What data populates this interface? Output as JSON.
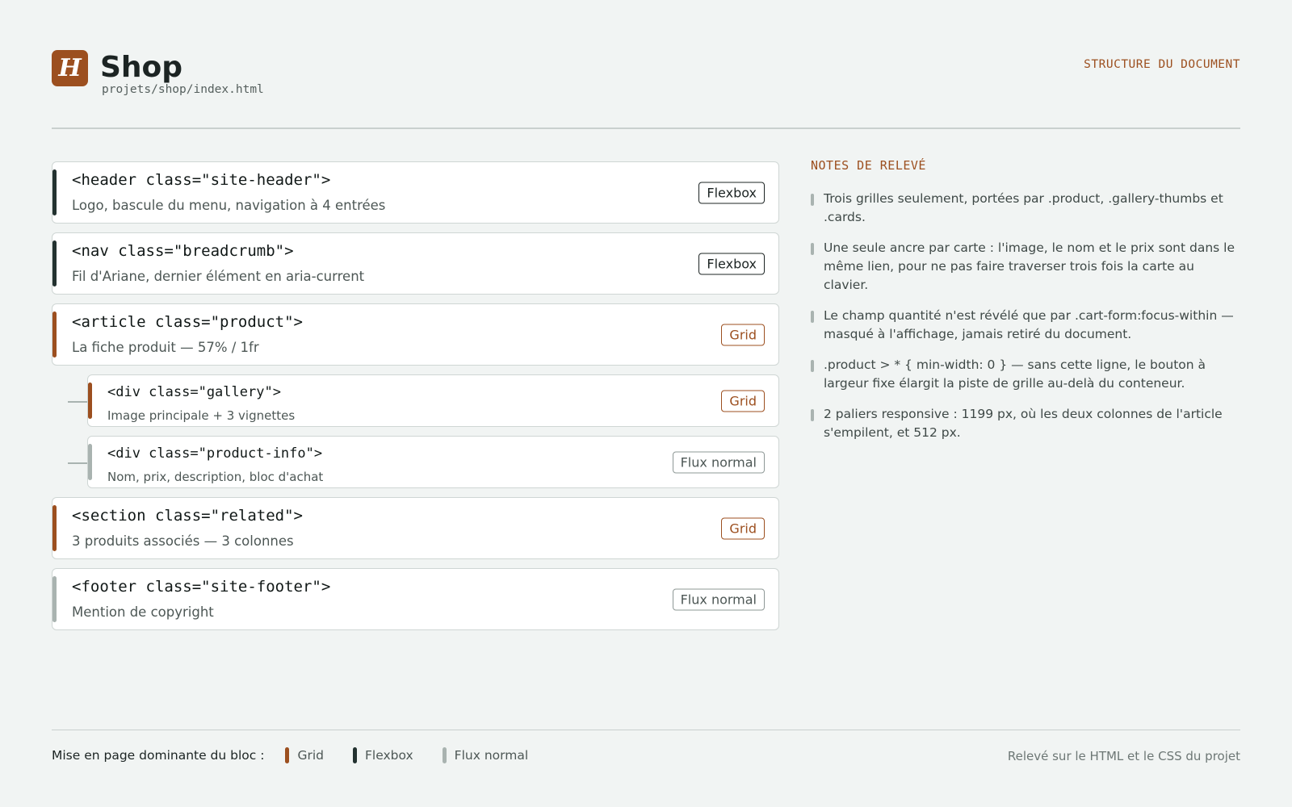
{
  "header": {
    "logo_letter": "H",
    "title": "Shop",
    "path": "projets/shop/index.html",
    "section_label": "STRUCTURE DU DOCUMENT"
  },
  "blocks": [
    {
      "tag": "<header class=\"site-header\">",
      "desc": "Logo, bascule du menu, navigation à 4 entrées",
      "layout": "flex",
      "badge": "Flexbox",
      "child": false
    },
    {
      "tag": "<nav class=\"breadcrumb\">",
      "desc": "Fil d'Ariane, dernier élément en aria-current",
      "layout": "flex",
      "badge": "Flexbox",
      "child": false
    },
    {
      "tag": "<article class=\"product\">",
      "desc": "La fiche produit — 57% / 1fr",
      "layout": "grid",
      "badge": "Grid",
      "child": false
    },
    {
      "tag": "<div class=\"gallery\">",
      "desc": "Image principale + 3 vignettes",
      "layout": "grid",
      "badge": "Grid",
      "child": true
    },
    {
      "tag": "<div class=\"product-info\">",
      "desc": "Nom, prix, description, bloc d'achat",
      "layout": "flow",
      "badge": "Flux normal",
      "child": true
    },
    {
      "tag": "<section class=\"related\">",
      "desc": "3 produits associés — 3 colonnes",
      "layout": "grid",
      "badge": "Grid",
      "child": false
    },
    {
      "tag": "<footer class=\"site-footer\">",
      "desc": "Mention de copyright",
      "layout": "flow",
      "badge": "Flux normal",
      "child": false
    }
  ],
  "notes": {
    "title": "NOTES DE RELEVÉ",
    "items": [
      "Trois grilles seulement, portées par .product, .gallery-thumbs et .cards.",
      "Une seule ancre par carte : l'image, le nom et le prix sont dans le même lien, pour ne pas faire traverser trois fois la carte au clavier.",
      "Le champ quantité n'est révélé que par .cart-form:focus-within — masqué à l'affichage, jamais retiré du document.",
      ".product > * { min-width: 0 } — sans cette ligne, le bouton à largeur fixe élargit la piste de grille au-delà du conteneur.",
      "2 paliers responsive : 1199 px, où les deux colonnes de l'article s'empilent, et 512 px."
    ]
  },
  "footer": {
    "legend_label": "Mise en page dominante du bloc :",
    "legend": [
      {
        "layout": "grid",
        "label": "Grid"
      },
      {
        "layout": "flex",
        "label": "Flexbox"
      },
      {
        "layout": "flow",
        "label": "Flux normal"
      }
    ],
    "note": "Relevé sur le HTML et le CSS du projet"
  },
  "colors": {
    "grid": "#9c4f1f",
    "flex": "#233230",
    "flow": "#a9b3b0",
    "background": "#f1f4f3"
  }
}
